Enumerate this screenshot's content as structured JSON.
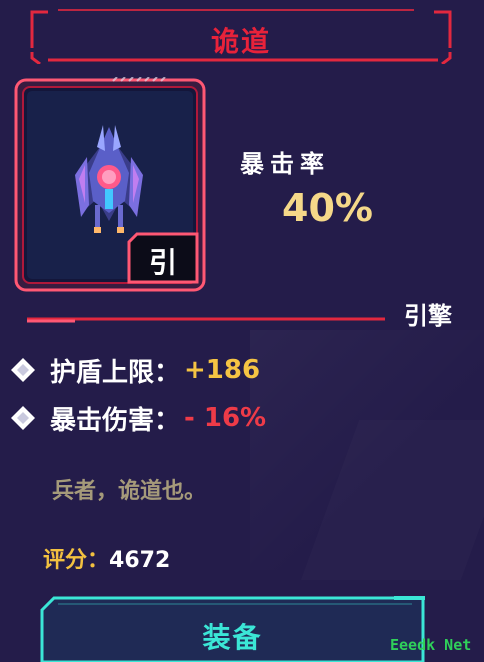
{
  "title": "诡道",
  "ship": {
    "type_badge": "引",
    "stat_label": "暴击率",
    "stat_value": "40%"
  },
  "category": "引擎",
  "attributes": [
    {
      "label": "护盾上限：",
      "value": "+186",
      "kind": "positive"
    },
    {
      "label": "暴击伤害：",
      "value": "- 16%",
      "kind": "negative"
    }
  ],
  "description": "兵者，诡道也。",
  "score": {
    "label": "评分：",
    "value": "4672"
  },
  "equip_label": "装备",
  "watermark": "Eeedk Net",
  "colors": {
    "background": "#241c4a",
    "title_red": "#e8223a",
    "frame_red": "#e2283f",
    "frame_pink": "#ff5874",
    "gold": "#f5d889",
    "positive": "#f5c443",
    "negative": "#ee3b48",
    "muted": "#a59a7a",
    "cyan": "#3be6d6",
    "score_label": "#f3c140"
  }
}
